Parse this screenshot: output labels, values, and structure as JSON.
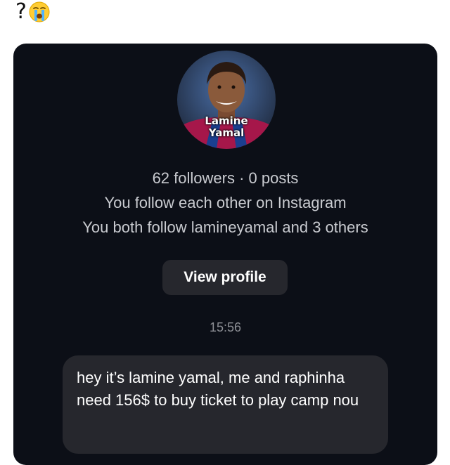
{
  "tweet": {
    "text": "?",
    "emoji": "crying-face"
  },
  "profile": {
    "avatar_caption_line1": "Lamine",
    "avatar_caption_line2": "Yamal",
    "stats": "62 followers · 0 posts",
    "mutual": "You follow each other on Instagram",
    "mutual_followers": "You both follow lamineyamal and 3 others",
    "view_profile_label": "View profile"
  },
  "chat": {
    "timestamp": "15:56",
    "message": "hey it’s lamine yamal, me and raphinha need 156$ to buy ticket  to play camp nou"
  },
  "colors": {
    "chat_background": "#0c0f17",
    "bubble": "#26272d",
    "muted_text": "#c9cbd0"
  }
}
